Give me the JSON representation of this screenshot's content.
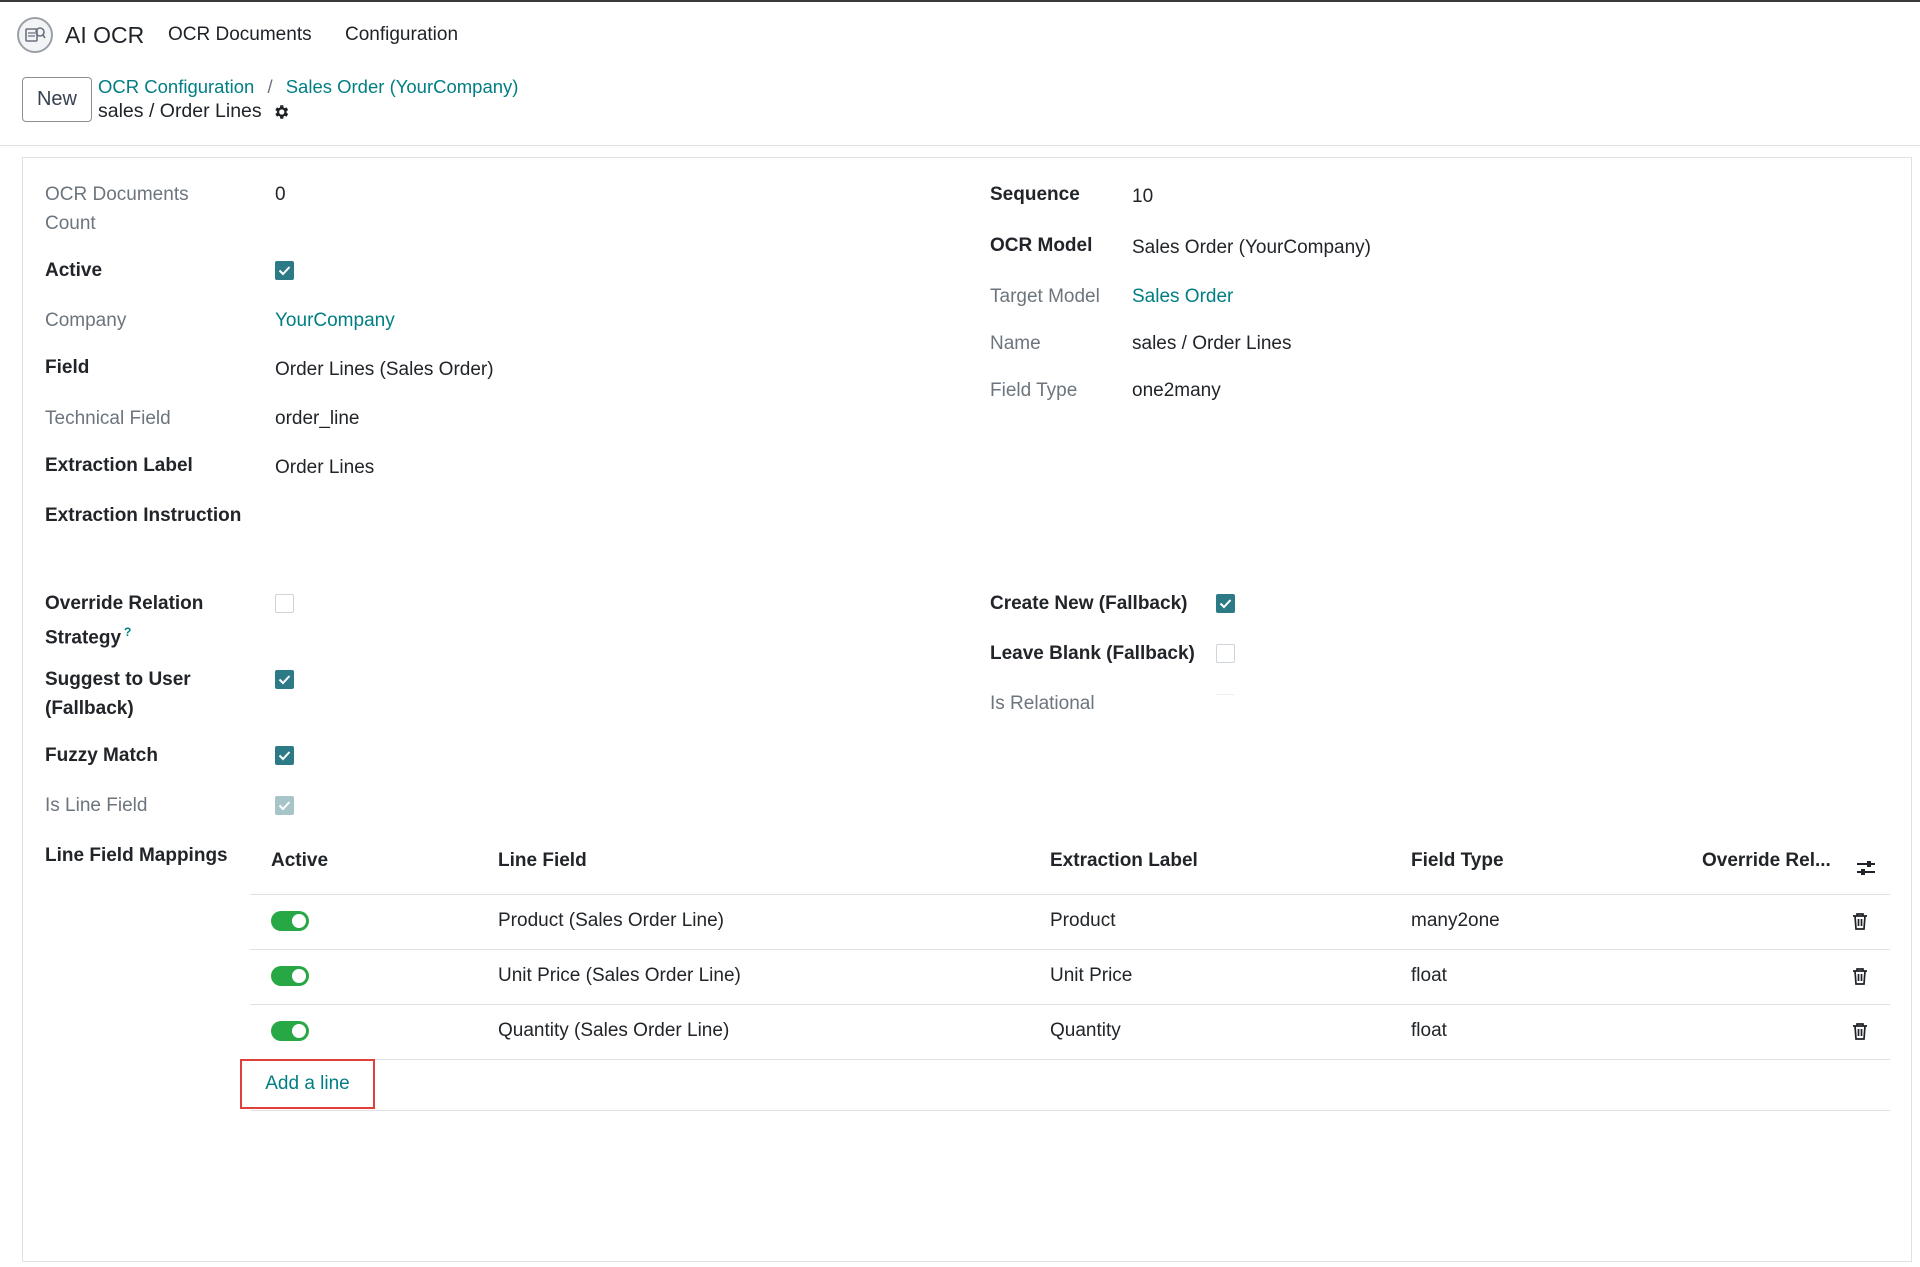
{
  "navbar": {
    "app_name": "AI OCR",
    "menus": [
      "OCR Documents",
      "Configuration"
    ],
    "logo_icon": "app-logo-icon"
  },
  "control_panel": {
    "new_label": "New",
    "breadcrumbs": [
      "OCR Configuration",
      "Sales Order (YourCompany)"
    ],
    "title": "sales / Order Lines",
    "gear_icon": "gear-icon"
  },
  "form": {
    "left": {
      "ocr_documents_count": {
        "label": "OCR Documents Count",
        "value": "0"
      },
      "active": {
        "label": "Active",
        "checked": true
      },
      "company": {
        "label": "Company",
        "value": "YourCompany"
      },
      "field": {
        "label": "Field",
        "value": "Order Lines (Sales Order)"
      },
      "technical_field": {
        "label": "Technical Field",
        "value": "order_line"
      },
      "extraction_label": {
        "label": "Extraction Label",
        "value": "Order Lines"
      },
      "extraction_instruction": {
        "label": "Extraction Instruction",
        "value": ""
      },
      "override_relation_strategy": {
        "label": "Override Relation Strategy",
        "help": "?",
        "checked": false
      },
      "suggest_to_user": {
        "label": "Suggest to User (Fallback)",
        "checked": true
      },
      "fuzzy_match": {
        "label": "Fuzzy Match",
        "checked": true
      },
      "is_line_field": {
        "label": "Is Line Field",
        "checked": true,
        "readonly": true
      },
      "line_field_mappings": {
        "label": "Line Field Mappings"
      }
    },
    "right": {
      "sequence": {
        "label": "Sequence",
        "value": "10"
      },
      "ocr_model": {
        "label": "OCR Model",
        "value": "Sales Order (YourCompany)"
      },
      "target_model": {
        "label": "Target Model",
        "value": "Sales Order"
      },
      "name": {
        "label": "Name",
        "value": "sales / Order Lines"
      },
      "field_type": {
        "label": "Field Type",
        "value": "one2many"
      },
      "create_new": {
        "label": "Create New (Fallback)",
        "checked": true
      },
      "leave_blank": {
        "label": "Leave Blank (Fallback)",
        "checked": false
      },
      "is_relational": {
        "label": "Is Relational",
        "checked": false
      }
    }
  },
  "mappings": {
    "columns": [
      "Active",
      "Line Field",
      "Extraction Label",
      "Field Type",
      "Override Rel..."
    ],
    "rows": [
      {
        "active": true,
        "line_field": "Product (Sales Order Line)",
        "extraction_label": "Product",
        "field_type": "many2one"
      },
      {
        "active": true,
        "line_field": "Unit Price (Sales Order Line)",
        "extraction_label": "Unit Price",
        "field_type": "float"
      },
      {
        "active": true,
        "line_field": "Quantity (Sales Order Line)",
        "extraction_label": "Quantity",
        "field_type": "float"
      }
    ],
    "add_line_label": "Add a line",
    "optional_columns_icon": "sliders-icon",
    "delete_icon": "trash-icon"
  },
  "colors": {
    "accent": "#017e84",
    "checkbox": "#2c7a86",
    "toggle_on": "#28a745",
    "highlight_border": "#e0403a"
  }
}
